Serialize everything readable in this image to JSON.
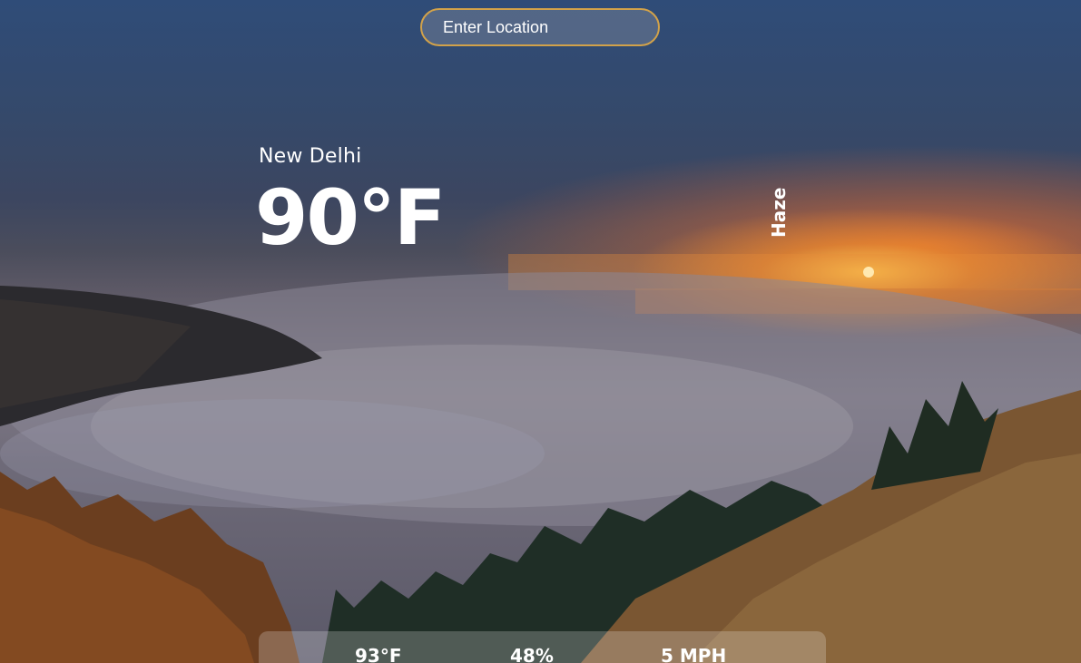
{
  "search": {
    "placeholder": "Enter Location",
    "value": ""
  },
  "weather": {
    "city": "New Delhi",
    "temperature": "90°F",
    "condition": "Haze"
  },
  "stats": {
    "feels_like": "93°F",
    "humidity": "48%",
    "wind": "5 MPH"
  },
  "colors": {
    "search_border": "#d2a24a",
    "text": "#ffffff",
    "sunset": "#ee6e2d"
  }
}
